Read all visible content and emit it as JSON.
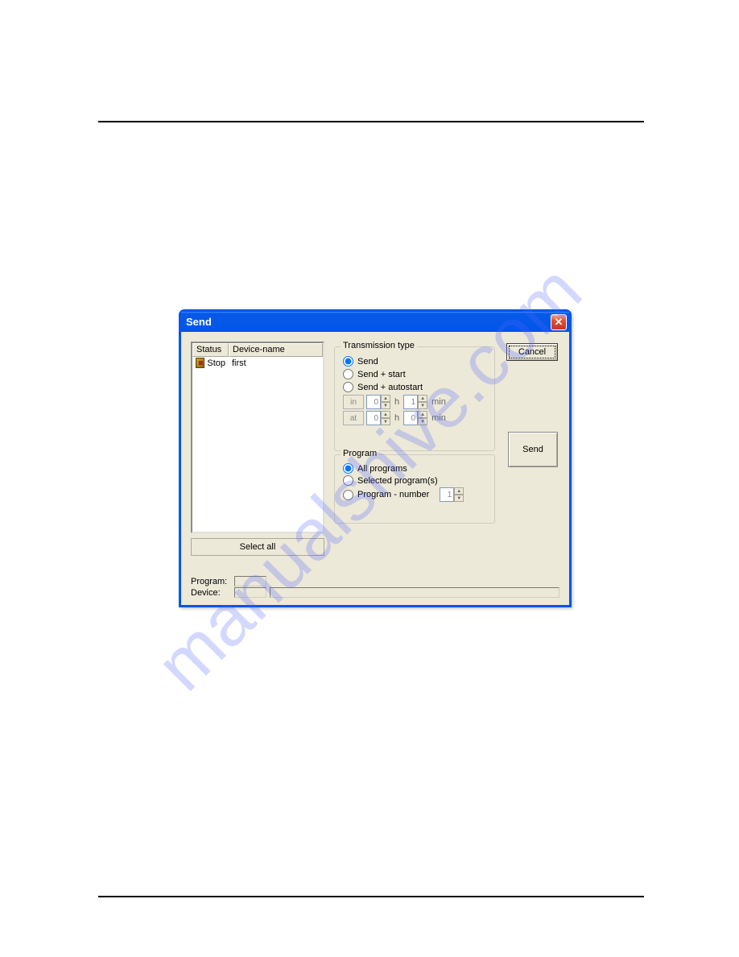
{
  "watermark": "manualshive.com",
  "dialog": {
    "title": "Send",
    "deviceList": {
      "headers": {
        "status": "Status",
        "deviceName": "Device-name"
      },
      "rows": [
        {
          "status": "Stop",
          "name": "first"
        }
      ]
    },
    "selectAll": "Select all",
    "transmission": {
      "title": "Transmission type",
      "options": {
        "send": "Send",
        "sendStart": "Send + start",
        "sendAutostart": "Send + autostart"
      },
      "timeButtons": {
        "in": "in",
        "at": "at"
      },
      "timeUnits": {
        "h": "h",
        "min": "min"
      },
      "timeValues": {
        "inH": "0",
        "inMin": "1",
        "atH": "0",
        "atMin": "0"
      }
    },
    "program": {
      "title": "Program",
      "options": {
        "all": "All programs",
        "selected": "Selected program(s)",
        "number": "Program - number"
      },
      "numberValue": "1"
    },
    "buttons": {
      "cancel": "Cancel",
      "send": "Send"
    },
    "statusLabels": {
      "program": "Program:",
      "device": "Device:"
    }
  }
}
